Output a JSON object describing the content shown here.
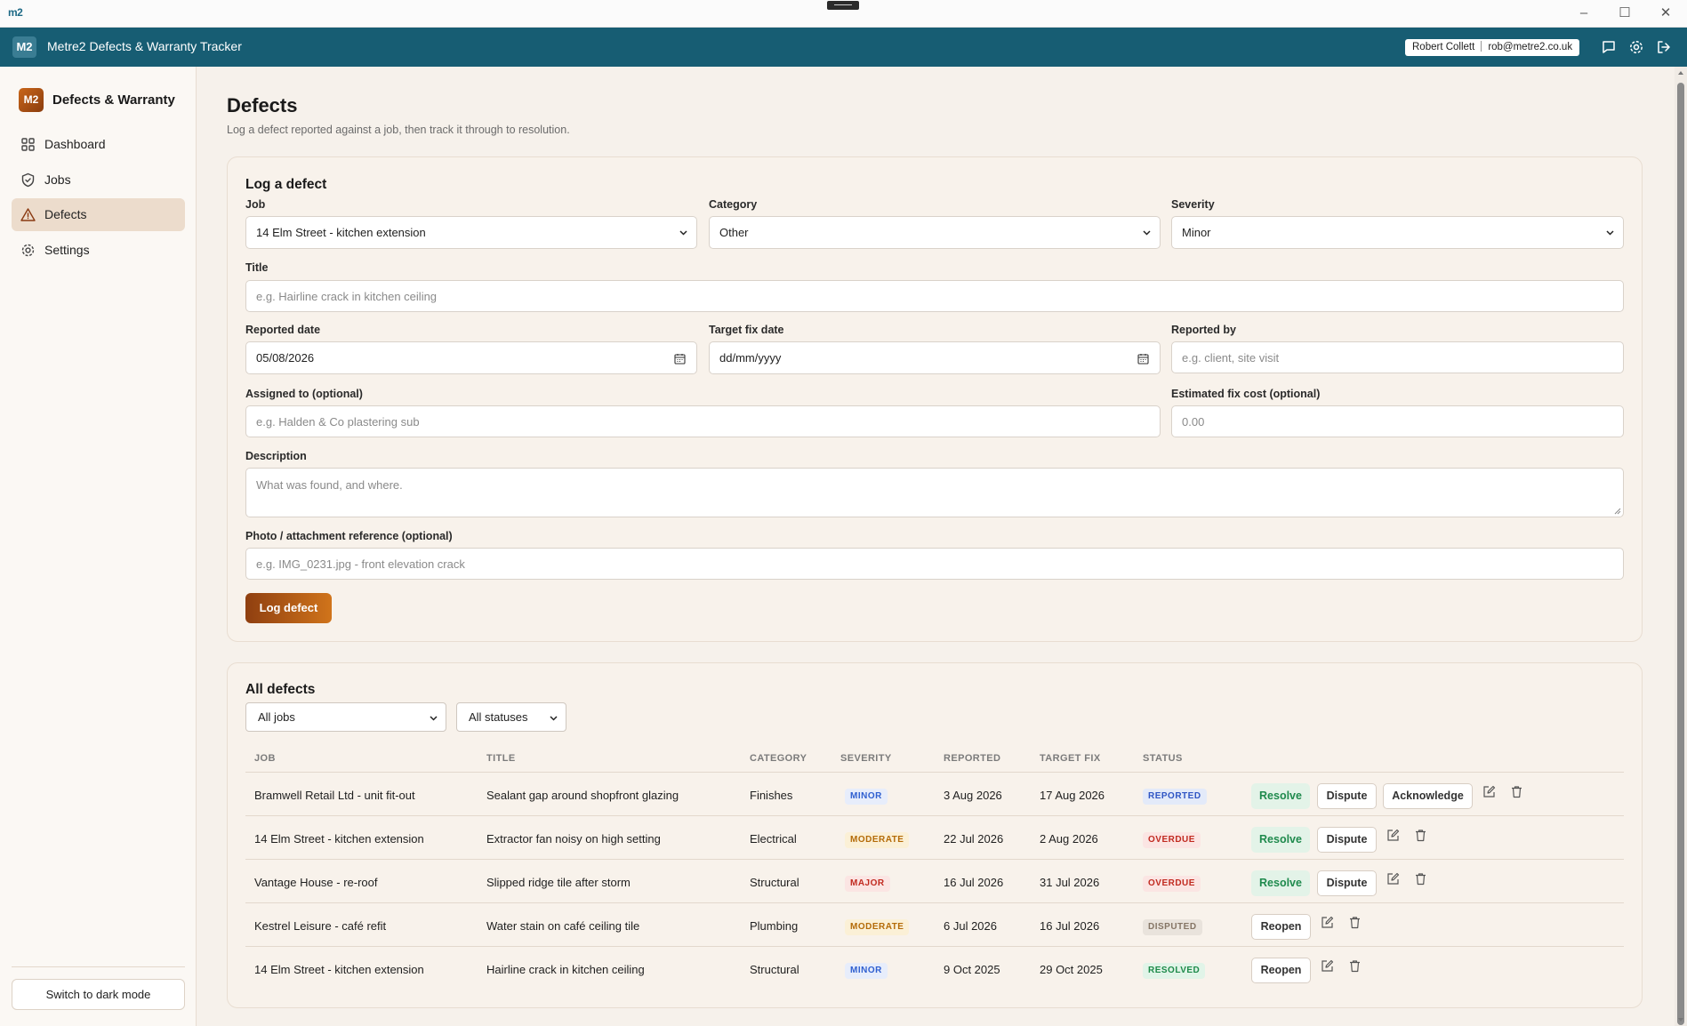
{
  "window": {
    "logo": "m2",
    "app_title": "Metre2 Defects & Warranty Tracker",
    "header_badge": "M2",
    "user_name": "Robert Collett",
    "user_email": "rob@metre2.co.uk"
  },
  "sidebar": {
    "brand_badge": "M2",
    "brand_text": "Defects & Warranty",
    "items": [
      {
        "label": "Dashboard",
        "icon": "grid-icon"
      },
      {
        "label": "Jobs",
        "icon": "shield-icon"
      },
      {
        "label": "Defects",
        "icon": "warning-icon",
        "active": true
      },
      {
        "label": "Settings",
        "icon": "gear-icon"
      }
    ],
    "dark_mode_label": "Switch to dark mode"
  },
  "page": {
    "title": "Defects",
    "subtitle": "Log a defect reported against a job, then track it through to resolution."
  },
  "form": {
    "card_title": "Log a defect",
    "job_label": "Job",
    "job_value": "14 Elm Street - kitchen extension",
    "category_label": "Category",
    "category_value": "Other",
    "severity_label": "Severity",
    "severity_value": "Minor",
    "title_label": "Title",
    "title_placeholder": "e.g. Hairline crack in kitchen ceiling",
    "reported_date_label": "Reported date",
    "reported_date_value": "05/08/2026",
    "target_fix_label": "Target fix date",
    "target_fix_value": "dd/mm/yyyy",
    "reported_by_label": "Reported by",
    "reported_by_placeholder": "e.g. client, site visit",
    "assigned_label": "Assigned to (optional)",
    "assigned_placeholder": "e.g. Halden & Co plastering sub",
    "cost_label": "Estimated fix cost (optional)",
    "cost_placeholder": "0.00",
    "description_label": "Description",
    "description_placeholder": "What was found, and where.",
    "photo_label": "Photo / attachment reference (optional)",
    "photo_placeholder": "e.g. IMG_0231.jpg - front elevation crack",
    "submit_label": "Log defect"
  },
  "list": {
    "card_title": "All defects",
    "job_filter": "All jobs",
    "status_filter": "All statuses",
    "columns": [
      "JOB",
      "TITLE",
      "CATEGORY",
      "SEVERITY",
      "REPORTED",
      "TARGET FIX",
      "STATUS"
    ],
    "rows": [
      {
        "job": "Bramwell Retail Ltd - unit fit-out",
        "title": "Sealant gap around shopfront glazing",
        "category": "Finishes",
        "severity": "MINOR",
        "reported": "3 Aug 2026",
        "target": "17 Aug 2026",
        "status": "REPORTED",
        "actions": [
          "Resolve",
          "Dispute",
          "Acknowledge"
        ]
      },
      {
        "job": "14 Elm Street - kitchen extension",
        "title": "Extractor fan noisy on high setting",
        "category": "Electrical",
        "severity": "MODERATE",
        "reported": "22 Jul 2026",
        "target": "2 Aug 2026",
        "status": "OVERDUE",
        "actions": [
          "Resolve",
          "Dispute"
        ]
      },
      {
        "job": "Vantage House - re-roof",
        "title": "Slipped ridge tile after storm",
        "category": "Structural",
        "severity": "MAJOR",
        "reported": "16 Jul 2026",
        "target": "31 Jul 2026",
        "status": "OVERDUE",
        "actions": [
          "Resolve",
          "Dispute"
        ]
      },
      {
        "job": "Kestrel Leisure - café refit",
        "title": "Water stain on café ceiling tile",
        "category": "Plumbing",
        "severity": "MODERATE",
        "reported": "6 Jul 2026",
        "target": "16 Jul 2026",
        "status": "DISPUTED",
        "actions": [
          "Reopen"
        ]
      },
      {
        "job": "14 Elm Street - kitchen extension",
        "title": "Hairline crack in kitchen ceiling",
        "category": "Structural",
        "severity": "MINOR",
        "reported": "9 Oct 2025",
        "target": "29 Oct 2025",
        "status": "RESOLVED",
        "actions": [
          "Reopen"
        ]
      }
    ]
  },
  "colors": {
    "header": "#175d73",
    "accent": "#c9661a",
    "page_bg": "#f6f1eb"
  }
}
